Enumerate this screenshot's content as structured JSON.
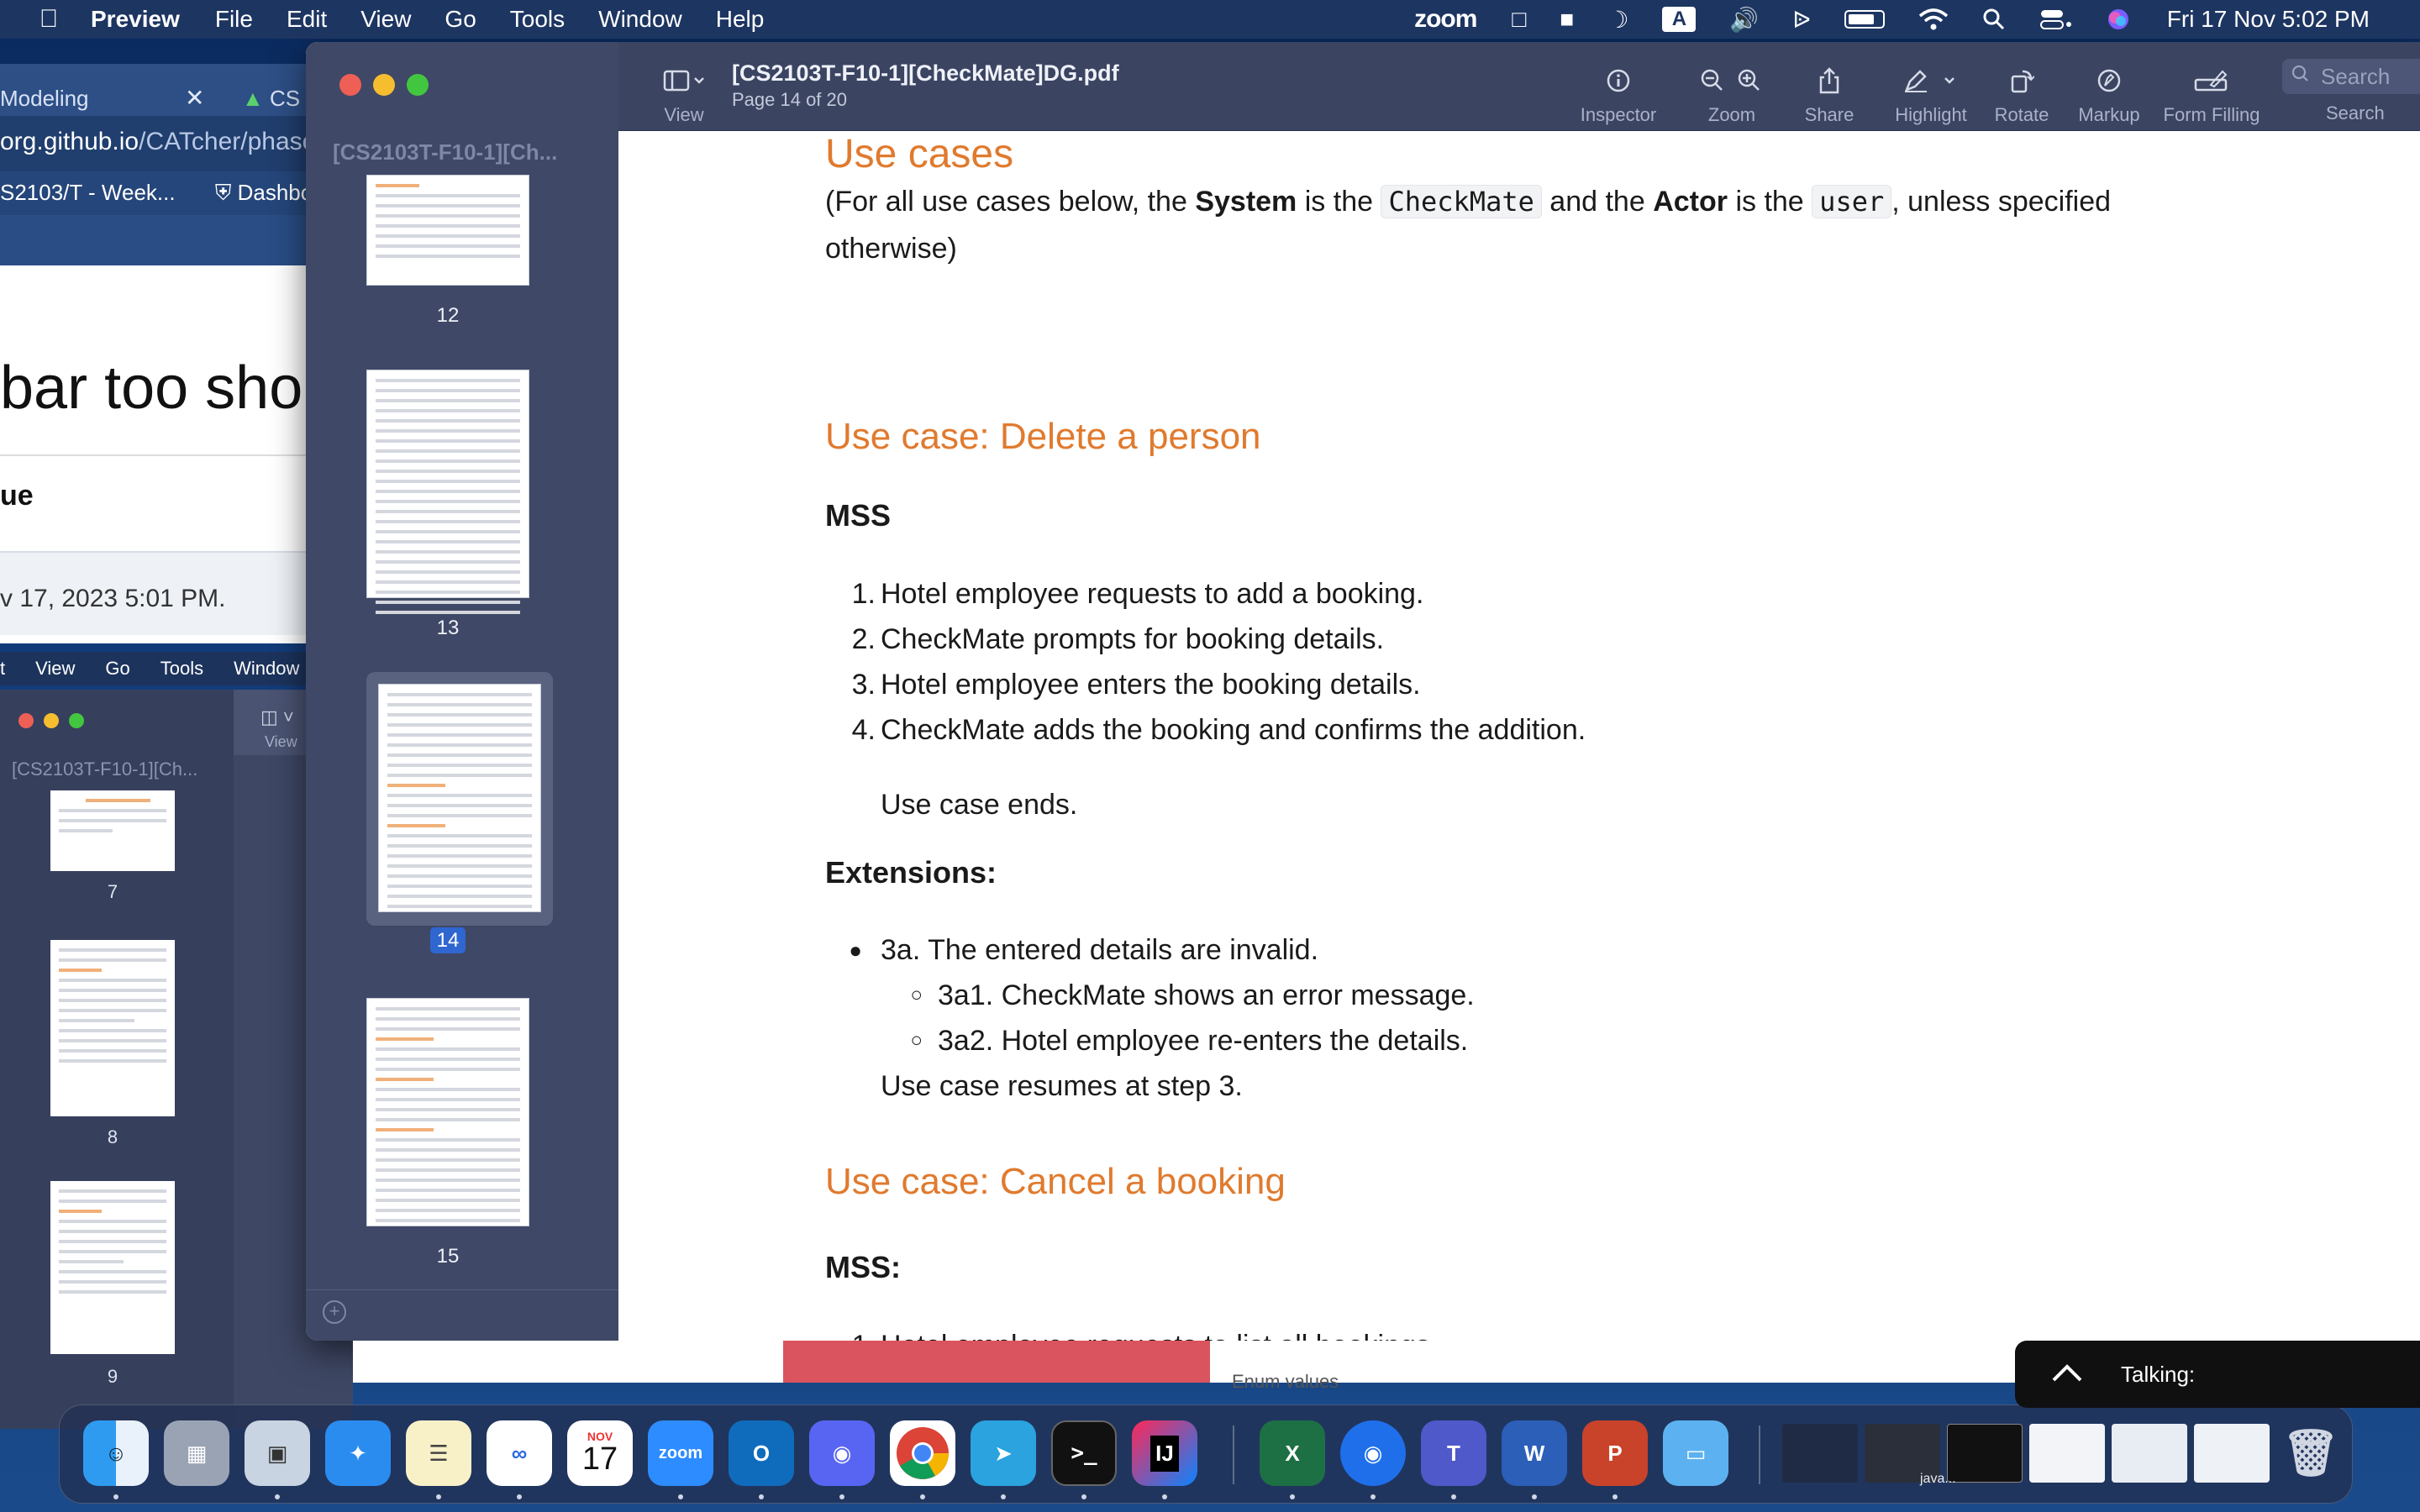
{
  "menubar": {
    "app": "Preview",
    "items": [
      "File",
      "Edit",
      "View",
      "Go",
      "Tools",
      "Window",
      "Help"
    ],
    "zoom": "zoom",
    "input_source": "A",
    "clock": "Fri 17 Nov  5:02 PM"
  },
  "bg_browser": {
    "tab1": "Modeling",
    "tab2": "CS",
    "url_host": "org.github.io",
    "url_path": "/CATcher/phase",
    "bookmark1": "S2103/T - Week...",
    "bookmark2": "Dashbo",
    "headline": "bar too short",
    "label": "ue",
    "date": "v 17, 2023 5:01 PM."
  },
  "bg_preview": {
    "menu": [
      "t",
      "View",
      "Go",
      "Tools",
      "Window",
      "I"
    ],
    "title": "[CS2103T-F10-1][Ch...",
    "thumbs": [
      "7",
      "8",
      "9"
    ],
    "view_label": "View"
  },
  "preview": {
    "sidebar_title": "[CS2103T-F10-1][Ch...",
    "thumbs": [
      "12",
      "13",
      "14",
      "15"
    ],
    "selected_page": "14",
    "doc_title": "[CS2103T-F10-1][CheckMate]DG.pdf",
    "doc_subtitle": "Page 14 of 20",
    "toolbar": {
      "view": "View",
      "inspector": "Inspector",
      "zoom": "Zoom",
      "share": "Share",
      "highlight": "Highlight",
      "rotate": "Rotate",
      "markup": "Markup",
      "form_filling": "Form Filling",
      "search_placeholder": "Search",
      "search_label": "Search"
    }
  },
  "doc": {
    "heading": "Use cases",
    "intro_a": "(For all use cases below, the ",
    "intro_system": "System",
    "intro_b": " is the ",
    "intro_code1": "CheckMate",
    "intro_c": " and the ",
    "intro_actor": "Actor",
    "intro_d": " is the ",
    "intro_code2": "user",
    "intro_e": ", unless specified",
    "intro_f": "otherwise)",
    "uc1_title": "Use case: Delete a person",
    "uc1_mss": "MSS",
    "uc1_steps": [
      "Hotel employee requests to add a booking.",
      "CheckMate prompts for booking details.",
      "Hotel employee enters the booking details.",
      "CheckMate adds the booking and confirms the addition."
    ],
    "uc1_end": "Use case ends.",
    "uc1_ext": "Extensions:",
    "uc1_ext_item": "3a. The entered details are invalid.",
    "uc1_ext_sub": [
      "3a1. CheckMate shows an error message.",
      "3a2. Hotel employee re-enters the details."
    ],
    "uc1_resume": "Use case resumes at step 3.",
    "uc2_title": "Use case: Cancel a booking",
    "uc2_mss": "MSS:",
    "uc2_step1": "Hotel employee requests to list all bookings."
  },
  "below": {
    "enum": "Enum values"
  },
  "talking": "Talking:",
  "dock": {
    "calendar_month": "NOV",
    "calendar_day": "17",
    "zoom": "zoom",
    "java": "java..."
  }
}
